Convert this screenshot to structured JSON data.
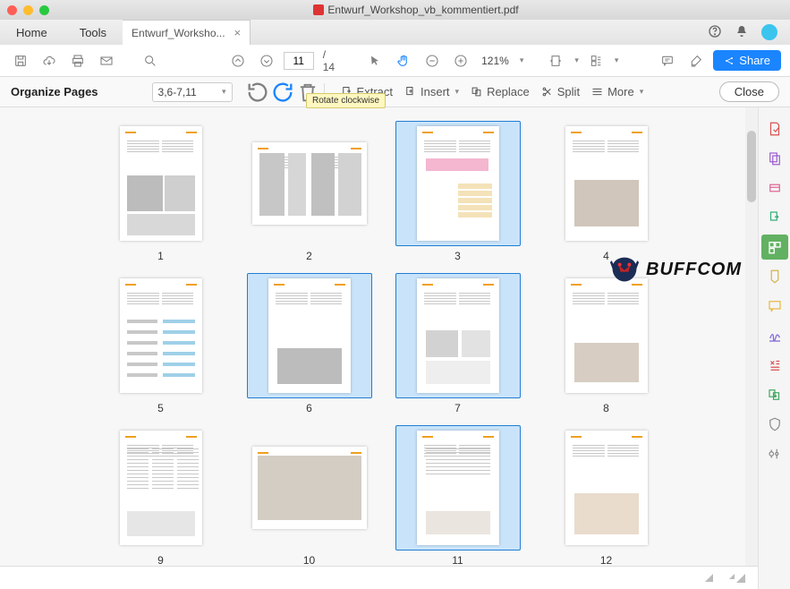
{
  "window": {
    "title": "Entwurf_Workshop_vb_kommentiert.pdf"
  },
  "tabs": {
    "home": "Home",
    "tools": "Tools",
    "doc": "Entwurf_Worksho...",
    "close_x": "×"
  },
  "toolbar": {
    "page": "11",
    "total": "/ 14",
    "zoom": "121%",
    "share": "Share"
  },
  "organize": {
    "title": "Organize Pages",
    "range": "3,6-7,11",
    "extract": "Extract",
    "insert": "Insert",
    "replace": "Replace",
    "split": "Split",
    "more": "More",
    "close": "Close",
    "tooltip": "Rotate clockwise"
  },
  "pages": [
    {
      "n": "1",
      "orient": "portrait",
      "sel": false
    },
    {
      "n": "2",
      "orient": "landscape",
      "sel": false
    },
    {
      "n": "3",
      "orient": "portrait",
      "sel": true
    },
    {
      "n": "4",
      "orient": "portrait",
      "sel": false
    },
    {
      "n": "5",
      "orient": "portrait",
      "sel": false
    },
    {
      "n": "6",
      "orient": "portrait",
      "sel": true
    },
    {
      "n": "7",
      "orient": "portrait",
      "sel": true
    },
    {
      "n": "8",
      "orient": "portrait",
      "sel": false
    },
    {
      "n": "9",
      "orient": "portrait",
      "sel": false
    },
    {
      "n": "10",
      "orient": "landscape",
      "sel": false
    },
    {
      "n": "11",
      "orient": "portrait",
      "sel": true
    },
    {
      "n": "12",
      "orient": "portrait",
      "sel": false
    }
  ],
  "watermark": "BUFFCOM"
}
